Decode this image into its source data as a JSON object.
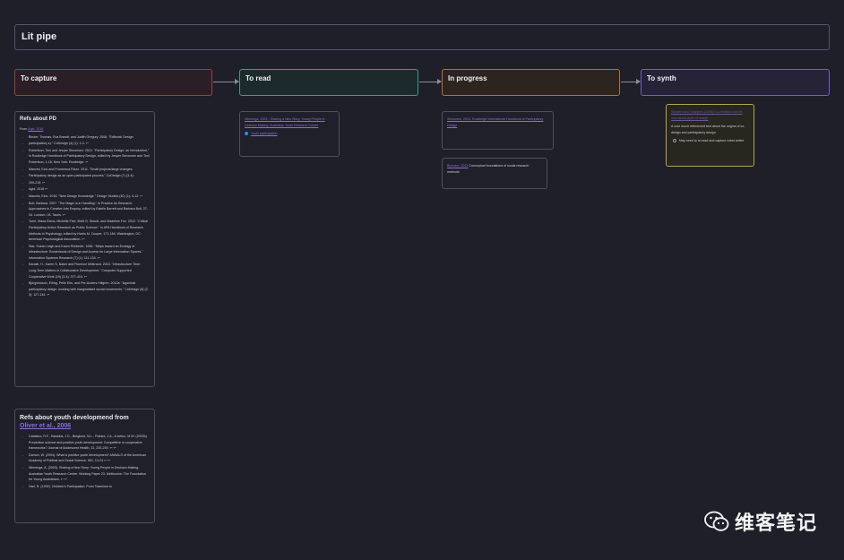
{
  "board": {
    "title": "Lit pipe"
  },
  "columns": [
    {
      "label": "To capture"
    },
    {
      "label": "To read"
    },
    {
      "label": "In progress"
    },
    {
      "label": "To synth"
    }
  ],
  "capture": {
    "refs_pd": {
      "title": "Refs about PD",
      "from_prefix": "From",
      "from_link": "Agid, 2016",
      "items": [
        "Binder, Thomas, Eva Brandt, and Judith Gregory. 2008. \"Editorial: Design",
        "participation(-s).\" CoDesign (4) (1): 1-3. ↩",
        "Robertson, Toni and Jesper Simonsen. 2012. \"Participatory Design: an Introduction,\" in Routledge Handbook of Participatory Design, edited by Jesper Simonsen and Toni Robertson, 1-18. New York: Routledge. ↩",
        "Manzini, Ezio and Francesca Rizzo. 2011. \"Small projects/large changes:",
        "Participatory design as an open participated process.\" CoDesign (7) (3-4):",
        "199-215. ↩",
        "Agid, 2016 ↩",
        "Manzini, Ezio. 2016. \"New Design Knowledge.\" Design Studies (30) (1): 4-12. ↩",
        "Bolt, Barbara. 2007. \"The Magic is in Handling.\" In Practice As Research: Approaches to Creative Arts Enquiry, edited by Estelle Barrett and Barbara Bolt, 27-34. London: I.B. Tauris. ↩",
        "Torre, Maria Elena, Michelle Fine, Brett G. Stoudt, and Madeline Fox. 2012. \"Critical Participatory Action Research as Public Science.\" In APA Handbook of Research Methods in Psychology, edited by Harris M. Cooper, 171-184. Washington, DC: American Psychological Association. ↩",
        "Star, Susan Leigh and Karen Ruhleder. 1996. \"Steps toward an Ecology of Infrastructure: Borderlands of Design and Access for Large Information Spaces.\" Information Systems Research (7) (1): 111-134. ↩",
        "Karasti, H., Karen S. Baker and Florence Millerand. 2010. \"Infrastructure Time: Long-Term Matters in Collaborative Development.\" Computer Supported Cooperative Work (19) (3-4): 377-415. ↩",
        "Björgvinsson, Erling, Pelle Ehn, and Per-Anders Hillgren. 2012a. \"Agonistic participatory design: working with marginalised social movements.\" CoDesign (8) (2-3): 127-144. ↩"
      ]
    },
    "refs_youth": {
      "title": "Refs about youth developmend from",
      "title_link": "Oliver et al., 2006",
      "items": [
        "Catalano, R.F., Hawkins, J.D., Berglund, M.L., Pollard, J.A., & Arthur, M.W. (2002b). Prevention science and positive youth development: Competitive or cooperative frameworks? Journal of Adolescent Health, 31, 230-239. ↩ ↩",
        "Damon, W. (2004). What is positive youth development? ANNALS of the American Academy of Political and Social Science, 591, 13-24 ↩ ↩",
        "Wierenga, A. (2003). Sharing a New Story: Young People in Decision Making. Australian Youth Research Centre, Working Paper 23. Melbourne: The Foundation for Young Australians. ↩ ↩",
        "Hart, R. (1992). Children's Participation: From Tokenism to"
      ]
    }
  },
  "to_read": {
    "card": {
      "link": "Wierenga, 2003 - Sharing a New Story: Young People in Decision Making. Australian Youth Research Centre",
      "tag": "Youth participation"
    }
  },
  "in_progress": {
    "card1": {
      "link": "Simonsen, 2013, Routledge International Handbook of Participatory Design"
    },
    "card2": {
      "link": "Bonnem, 2013",
      "text": "Conceptual foundations of social research methods"
    }
  },
  "to_synth": {
    "card": {
      "link": "Sanders and Stappers (2008) Co-creation and the new landscapes of design",
      "text": "A core much referenced text about the origins of co-design and participatory design",
      "check": "May need to re-read and capture notes better"
    }
  },
  "watermark": {
    "text": "维客笔记"
  },
  "colors": {
    "capture": "#a63a3f",
    "read": "#3b9c8f",
    "progress": "#b07236",
    "synth": "#7a5fbf",
    "link": "#8c6fd6"
  }
}
